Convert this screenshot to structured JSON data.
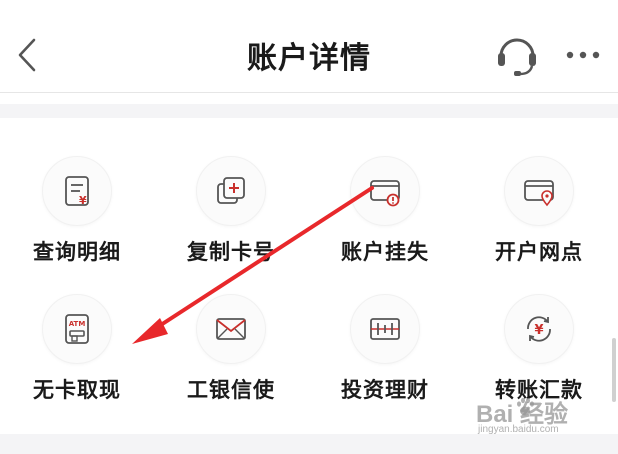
{
  "header": {
    "title": "账户详情",
    "back_icon": "chevron-left-icon",
    "support_icon": "headset-icon",
    "more_icon": "more-dots-icon"
  },
  "grid": {
    "rows": [
      [
        {
          "label": "查询明细",
          "icon": "statement-yuan-icon"
        },
        {
          "label": "复制卡号",
          "icon": "copy-plus-icon"
        },
        {
          "label": "账户挂失",
          "icon": "card-warning-icon"
        },
        {
          "label": "开户网点",
          "icon": "card-location-icon"
        }
      ],
      [
        {
          "label": "无卡取现",
          "icon": "atm-icon",
          "icon_text": "ATM"
        },
        {
          "label": "工银信使",
          "icon": "envelope-icon"
        },
        {
          "label": "投资理财",
          "icon": "chart-bars-icon"
        },
        {
          "label": "转账汇款",
          "icon": "transfer-yuan-icon"
        }
      ]
    ]
  },
  "annotation": {
    "type": "arrow",
    "color": "#e8282b"
  },
  "watermark": {
    "logo": "Bai  经验",
    "sub": "jingyan.baidu.com"
  },
  "colors": {
    "accent": "#c9302c",
    "icon_stroke": "#555555",
    "arrow": "#e8282b"
  }
}
